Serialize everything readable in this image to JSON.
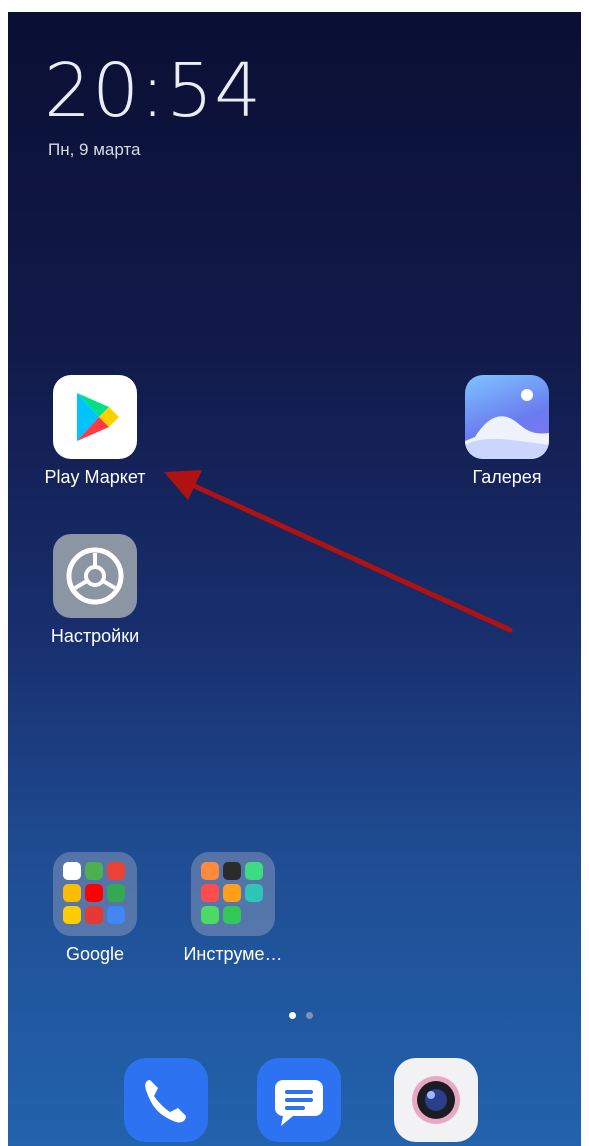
{
  "status": {
    "time": "20:54",
    "date": "Пн, 9 марта"
  },
  "apps": {
    "play_market": {
      "label": "Play Маркет",
      "icon": "google-play-icon"
    },
    "gallery": {
      "label": "Галерея",
      "icon": "gallery-icon"
    },
    "settings": {
      "label": "Настройки",
      "icon": "gear-icon"
    }
  },
  "folders": {
    "google": {
      "label": "Google",
      "icon": "google-folder-icon"
    },
    "tools": {
      "label": "Инструме…",
      "icon": "tools-folder-icon"
    }
  },
  "page_indicator": {
    "pages": 2,
    "current": 1
  },
  "dock": {
    "items": [
      "phone-icon",
      "messages-icon",
      "camera-icon"
    ]
  },
  "colors": {
    "annotation_arrow": "#b01212",
    "dock_blue": "#2d72f0"
  }
}
